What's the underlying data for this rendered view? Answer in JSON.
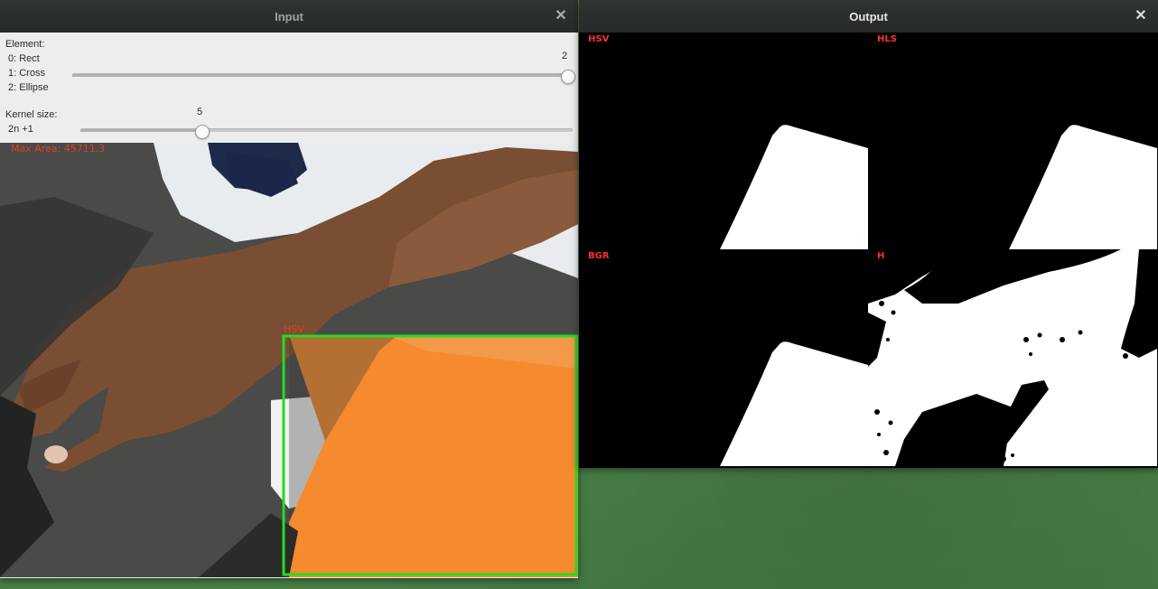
{
  "input_window": {
    "title": "Input",
    "close_icon": "close-icon",
    "element_label": "Element:",
    "element_options": [
      "0: Rect",
      "1: Cross",
      "2: Ellipse"
    ],
    "element_value": "2",
    "element_level": 1.0,
    "kernel_label": "Kernel size:",
    "kernel_formula": "2n +1",
    "kernel_value": "5",
    "kernel_level": 0.245,
    "overlay_text": "Max Area: 45711.3",
    "box_label": "HSV",
    "box_color": "#22dd22"
  },
  "output_window": {
    "title": "Output",
    "close_icon": "close-icon",
    "quadrants": [
      "HSV",
      "HLS",
      "BGR",
      "H"
    ],
    "label_color": "#ff3030"
  }
}
